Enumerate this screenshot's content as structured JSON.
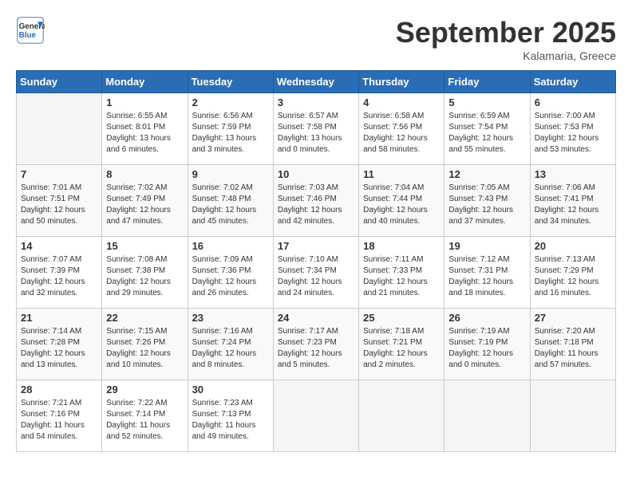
{
  "logo": {
    "line1": "General",
    "line2": "Blue"
  },
  "title": "September 2025",
  "location": "Kalamaria, Greece",
  "days_of_week": [
    "Sunday",
    "Monday",
    "Tuesday",
    "Wednesday",
    "Thursday",
    "Friday",
    "Saturday"
  ],
  "weeks": [
    [
      {
        "day": "",
        "sunrise": "",
        "sunset": "",
        "daylight": ""
      },
      {
        "day": "1",
        "sunrise": "Sunrise: 6:55 AM",
        "sunset": "Sunset: 8:01 PM",
        "daylight": "Daylight: 13 hours and 6 minutes."
      },
      {
        "day": "2",
        "sunrise": "Sunrise: 6:56 AM",
        "sunset": "Sunset: 7:59 PM",
        "daylight": "Daylight: 13 hours and 3 minutes."
      },
      {
        "day": "3",
        "sunrise": "Sunrise: 6:57 AM",
        "sunset": "Sunset: 7:58 PM",
        "daylight": "Daylight: 13 hours and 0 minutes."
      },
      {
        "day": "4",
        "sunrise": "Sunrise: 6:58 AM",
        "sunset": "Sunset: 7:56 PM",
        "daylight": "Daylight: 12 hours and 58 minutes."
      },
      {
        "day": "5",
        "sunrise": "Sunrise: 6:59 AM",
        "sunset": "Sunset: 7:54 PM",
        "daylight": "Daylight: 12 hours and 55 minutes."
      },
      {
        "day": "6",
        "sunrise": "Sunrise: 7:00 AM",
        "sunset": "Sunset: 7:53 PM",
        "daylight": "Daylight: 12 hours and 53 minutes."
      }
    ],
    [
      {
        "day": "7",
        "sunrise": "Sunrise: 7:01 AM",
        "sunset": "Sunset: 7:51 PM",
        "daylight": "Daylight: 12 hours and 50 minutes."
      },
      {
        "day": "8",
        "sunrise": "Sunrise: 7:02 AM",
        "sunset": "Sunset: 7:49 PM",
        "daylight": "Daylight: 12 hours and 47 minutes."
      },
      {
        "day": "9",
        "sunrise": "Sunrise: 7:02 AM",
        "sunset": "Sunset: 7:48 PM",
        "daylight": "Daylight: 12 hours and 45 minutes."
      },
      {
        "day": "10",
        "sunrise": "Sunrise: 7:03 AM",
        "sunset": "Sunset: 7:46 PM",
        "daylight": "Daylight: 12 hours and 42 minutes."
      },
      {
        "day": "11",
        "sunrise": "Sunrise: 7:04 AM",
        "sunset": "Sunset: 7:44 PM",
        "daylight": "Daylight: 12 hours and 40 minutes."
      },
      {
        "day": "12",
        "sunrise": "Sunrise: 7:05 AM",
        "sunset": "Sunset: 7:43 PM",
        "daylight": "Daylight: 12 hours and 37 minutes."
      },
      {
        "day": "13",
        "sunrise": "Sunrise: 7:06 AM",
        "sunset": "Sunset: 7:41 PM",
        "daylight": "Daylight: 12 hours and 34 minutes."
      }
    ],
    [
      {
        "day": "14",
        "sunrise": "Sunrise: 7:07 AM",
        "sunset": "Sunset: 7:39 PM",
        "daylight": "Daylight: 12 hours and 32 minutes."
      },
      {
        "day": "15",
        "sunrise": "Sunrise: 7:08 AM",
        "sunset": "Sunset: 7:38 PM",
        "daylight": "Daylight: 12 hours and 29 minutes."
      },
      {
        "day": "16",
        "sunrise": "Sunrise: 7:09 AM",
        "sunset": "Sunset: 7:36 PM",
        "daylight": "Daylight: 12 hours and 26 minutes."
      },
      {
        "day": "17",
        "sunrise": "Sunrise: 7:10 AM",
        "sunset": "Sunset: 7:34 PM",
        "daylight": "Daylight: 12 hours and 24 minutes."
      },
      {
        "day": "18",
        "sunrise": "Sunrise: 7:11 AM",
        "sunset": "Sunset: 7:33 PM",
        "daylight": "Daylight: 12 hours and 21 minutes."
      },
      {
        "day": "19",
        "sunrise": "Sunrise: 7:12 AM",
        "sunset": "Sunset: 7:31 PM",
        "daylight": "Daylight: 12 hours and 18 minutes."
      },
      {
        "day": "20",
        "sunrise": "Sunrise: 7:13 AM",
        "sunset": "Sunset: 7:29 PM",
        "daylight": "Daylight: 12 hours and 16 minutes."
      }
    ],
    [
      {
        "day": "21",
        "sunrise": "Sunrise: 7:14 AM",
        "sunset": "Sunset: 7:28 PM",
        "daylight": "Daylight: 12 hours and 13 minutes."
      },
      {
        "day": "22",
        "sunrise": "Sunrise: 7:15 AM",
        "sunset": "Sunset: 7:26 PM",
        "daylight": "Daylight: 12 hours and 10 minutes."
      },
      {
        "day": "23",
        "sunrise": "Sunrise: 7:16 AM",
        "sunset": "Sunset: 7:24 PM",
        "daylight": "Daylight: 12 hours and 8 minutes."
      },
      {
        "day": "24",
        "sunrise": "Sunrise: 7:17 AM",
        "sunset": "Sunset: 7:23 PM",
        "daylight": "Daylight: 12 hours and 5 minutes."
      },
      {
        "day": "25",
        "sunrise": "Sunrise: 7:18 AM",
        "sunset": "Sunset: 7:21 PM",
        "daylight": "Daylight: 12 hours and 2 minutes."
      },
      {
        "day": "26",
        "sunrise": "Sunrise: 7:19 AM",
        "sunset": "Sunset: 7:19 PM",
        "daylight": "Daylight: 12 hours and 0 minutes."
      },
      {
        "day": "27",
        "sunrise": "Sunrise: 7:20 AM",
        "sunset": "Sunset: 7:18 PM",
        "daylight": "Daylight: 11 hours and 57 minutes."
      }
    ],
    [
      {
        "day": "28",
        "sunrise": "Sunrise: 7:21 AM",
        "sunset": "Sunset: 7:16 PM",
        "daylight": "Daylight: 11 hours and 54 minutes."
      },
      {
        "day": "29",
        "sunrise": "Sunrise: 7:22 AM",
        "sunset": "Sunset: 7:14 PM",
        "daylight": "Daylight: 11 hours and 52 minutes."
      },
      {
        "day": "30",
        "sunrise": "Sunrise: 7:23 AM",
        "sunset": "Sunset: 7:13 PM",
        "daylight": "Daylight: 11 hours and 49 minutes."
      },
      {
        "day": "",
        "sunrise": "",
        "sunset": "",
        "daylight": ""
      },
      {
        "day": "",
        "sunrise": "",
        "sunset": "",
        "daylight": ""
      },
      {
        "day": "",
        "sunrise": "",
        "sunset": "",
        "daylight": ""
      },
      {
        "day": "",
        "sunrise": "",
        "sunset": "",
        "daylight": ""
      }
    ]
  ]
}
